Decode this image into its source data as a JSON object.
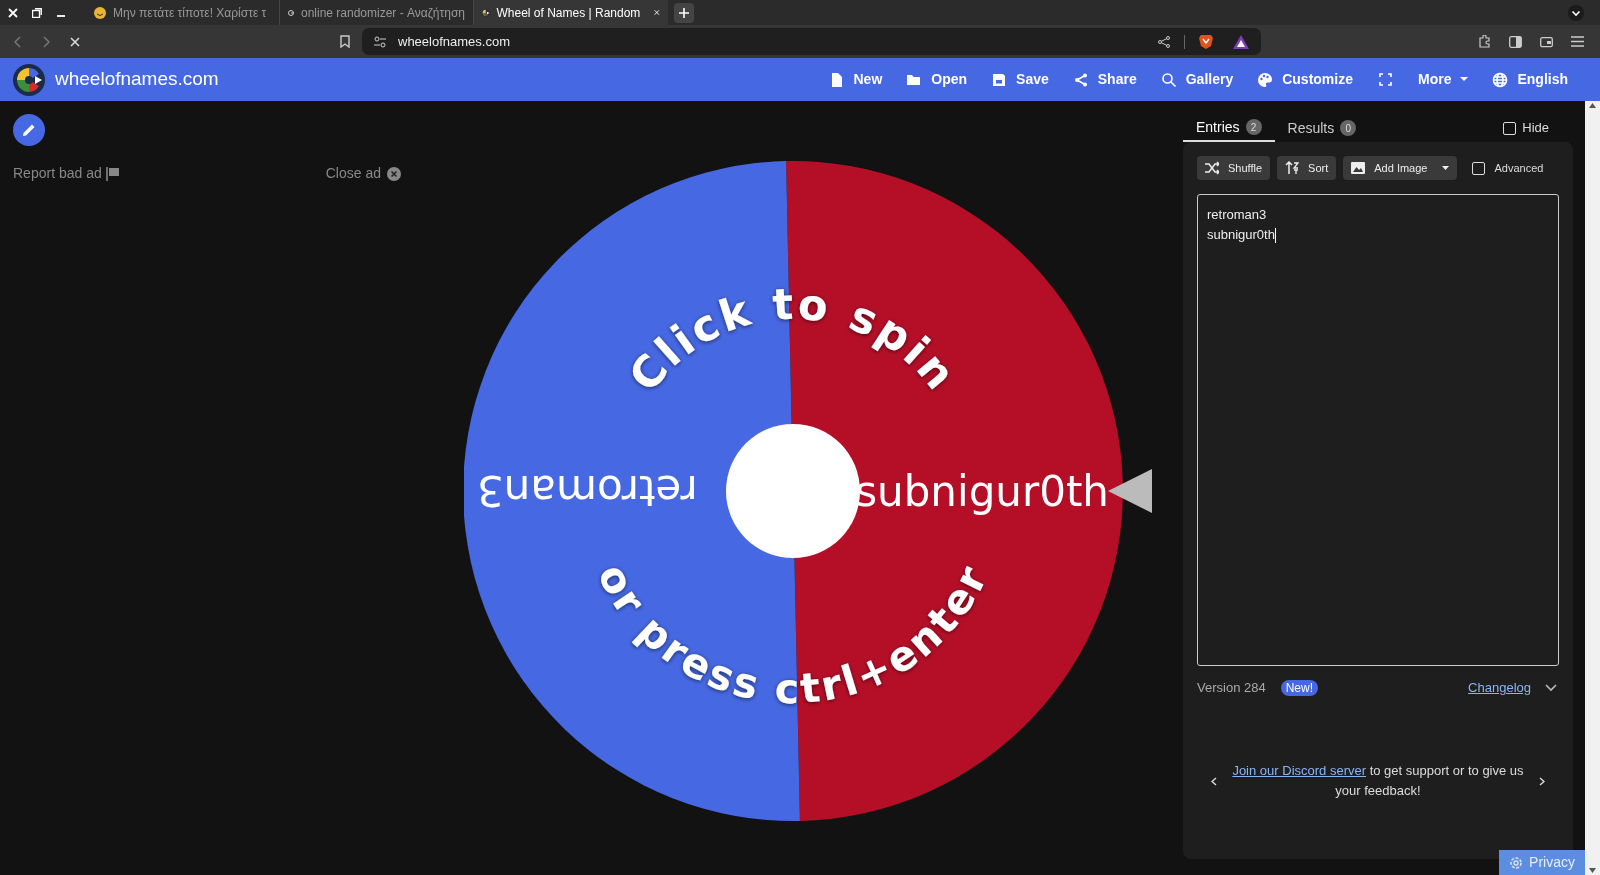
{
  "browser": {
    "tabs": [
      {
        "title": "Μην πετάτε τίποτε! Χαρίστε τ",
        "selected": false
      },
      {
        "title": "online randomizer - Αναζήτηση",
        "selected": false
      },
      {
        "title": "Wheel of Names | Random",
        "selected": true
      }
    ],
    "address": "wheelofnames.com"
  },
  "header": {
    "brand": "wheelofnames.com",
    "nav": [
      {
        "label": "New"
      },
      {
        "label": "Open"
      },
      {
        "label": "Save"
      },
      {
        "label": "Share"
      },
      {
        "label": "Gallery"
      },
      {
        "label": "Customize"
      },
      {
        "label": "More"
      },
      {
        "label": "English"
      }
    ]
  },
  "ad": {
    "report": "Report bad ad",
    "close": "Close ad"
  },
  "wheel": {
    "prompt_top": "Click to spin",
    "prompt_bottom": "or press ctrl+enter",
    "segments": [
      {
        "label": "subnigur0th",
        "color": "#b50f28"
      },
      {
        "label": "retroman3",
        "color": "#4668e2"
      }
    ]
  },
  "panel": {
    "tabs": [
      {
        "label": "Entries",
        "count": "2",
        "selected": true
      },
      {
        "label": "Results",
        "count": "0",
        "selected": false
      }
    ],
    "hide": {
      "label": "Hide",
      "checked": false
    },
    "tools": [
      {
        "label": "Shuffle"
      },
      {
        "label": "Sort"
      },
      {
        "label": "Add Image"
      }
    ],
    "advanced": {
      "label": "Advanced",
      "checked": false
    },
    "entries": [
      "retroman3",
      "subnigur0th"
    ],
    "version": "Version 284",
    "new_badge": "New!",
    "changelog": "Changelog",
    "message": {
      "link": "Join our Discord server",
      "text": " to get support or to give us your feedback!"
    }
  },
  "privacy": "Privacy"
}
